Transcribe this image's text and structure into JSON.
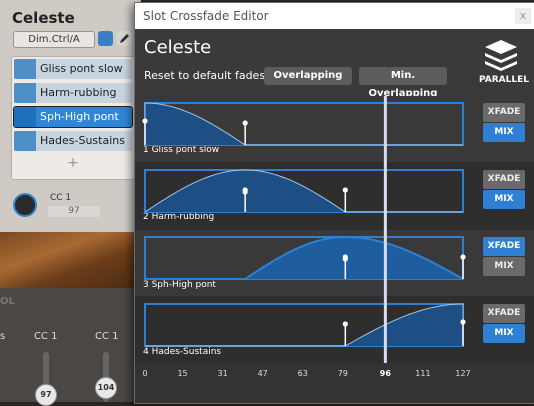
{
  "background_panel": {
    "title": "Celeste",
    "dim_selector": "Dim.Ctrl/A",
    "articulations": [
      "Gliss pont slow",
      "Harm-rubbing",
      "Sph-High pont",
      "Hades-Sustains"
    ],
    "selected_articulation": "Sph-High pont",
    "add_label": "+",
    "cc_label": "CC 1",
    "cc_value": "97",
    "lower_title_fragment": "OL",
    "lower_left_fragment": "s",
    "faders": [
      {
        "label": "CC 1",
        "value": "97"
      },
      {
        "label": "CC 1",
        "value": "104"
      }
    ]
  },
  "dialog": {
    "title": "Slot Crossfade Editor",
    "close_glyph": "x",
    "instrument": "Celeste",
    "reset_label": "Reset to default fades:",
    "reset_buttons": [
      "Overlapping",
      "Min. Overlapping"
    ],
    "mode_label": "PARALLEL",
    "xfade_label": "XFADE",
    "mix_label": "MIX",
    "accent_color": "#2f7fd2",
    "slots": [
      {
        "label": "1 Gliss pont slow",
        "fade_in": [
          0,
          0
        ],
        "fade_out": [
          0,
          40
        ],
        "mode": "MIX",
        "active": false
      },
      {
        "label": "2 Harm-rubbing",
        "fade_in": [
          0,
          40
        ],
        "fade_out": [
          40,
          80
        ],
        "mode": "MIX",
        "active": false
      },
      {
        "label": "3 Sph-High pont",
        "fade_in": [
          40,
          80
        ],
        "fade_out": [
          80,
          127
        ],
        "mode": "XFADE",
        "active": true
      },
      {
        "label": "4 Hades-Sustains",
        "fade_in": [
          80,
          127
        ],
        "fade_out": [
          127,
          127
        ],
        "mode": "MIX",
        "active": false
      }
    ],
    "ruler_ticks": [
      0,
      15,
      31,
      47,
      63,
      79,
      96,
      111,
      127
    ],
    "cursor_value": 96
  }
}
